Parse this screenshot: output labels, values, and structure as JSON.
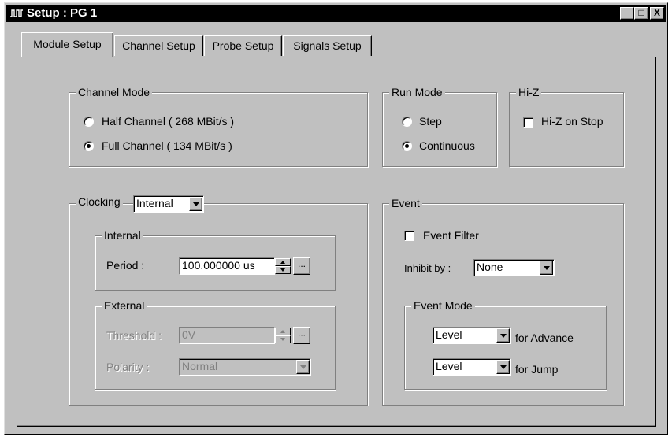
{
  "window": {
    "title": "Setup : PG 1",
    "icon": "pulse-icon"
  },
  "controls": {
    "minimize": "_",
    "maximize": "□",
    "close": "X"
  },
  "tabs": [
    {
      "label": "Module Setup",
      "active": true
    },
    {
      "label": "Channel Setup",
      "active": false
    },
    {
      "label": "Probe Setup",
      "active": false
    },
    {
      "label": "Signals Setup",
      "active": false
    }
  ],
  "channel_mode": {
    "title": "Channel Mode",
    "options": [
      {
        "label": "Half Channel ( 268 MBit/s )",
        "selected": false
      },
      {
        "label": "Full Channel  ( 134 MBit/s )",
        "selected": true
      }
    ]
  },
  "run_mode": {
    "title": "Run Mode",
    "options": [
      {
        "label": "Step",
        "selected": false
      },
      {
        "label": "Continuous",
        "selected": true
      }
    ]
  },
  "hiz": {
    "title": "Hi-Z",
    "checkbox_label": "Hi-Z on Stop",
    "checked": false
  },
  "clocking": {
    "title": "Clocking",
    "mode_value": "Internal",
    "internal": {
      "title": "Internal",
      "period_label": "Period :",
      "period_value": "100.000000 us",
      "browse": "..."
    },
    "external": {
      "title": "External",
      "threshold_label": "Threshold :",
      "threshold_value": "0V",
      "browse": "...",
      "polarity_label": "Polarity :",
      "polarity_value": "Normal"
    }
  },
  "event": {
    "title": "Event",
    "filter_label": "Event Filter",
    "filter_checked": false,
    "inhibit_label": "Inhibit by :",
    "inhibit_value": "None",
    "event_mode": {
      "title": "Event Mode",
      "advance_value": "Level",
      "advance_label": "for Advance",
      "jump_value": "Level",
      "jump_label": "for Jump"
    }
  }
}
